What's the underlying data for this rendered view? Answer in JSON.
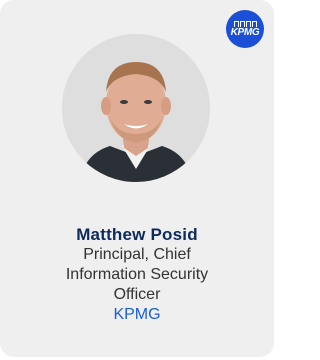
{
  "card": {
    "logo_badge": {
      "text": "KPMG",
      "icon": "kpmg-logo-icon",
      "color": "#1a4fd6"
    },
    "avatar": {
      "icon": "person-photo"
    },
    "person": {
      "name": "Matthew Posid",
      "title_lines": [
        "Principal, Chief",
        "Information Security",
        "Officer"
      ],
      "company": "KPMG"
    }
  },
  "colors": {
    "card_background": "#efefef",
    "name": "#0d2a5c",
    "company": "#1a5fd6"
  }
}
